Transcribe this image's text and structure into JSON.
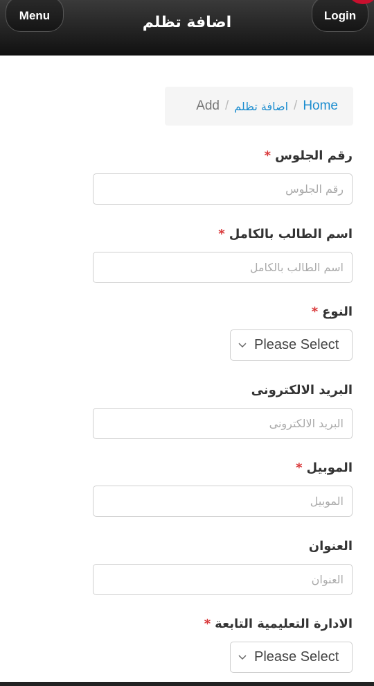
{
  "header": {
    "menu_label": "Menu",
    "title": "اضافة تظلم",
    "login_label": "Login"
  },
  "breadcrumb": {
    "home": "Home",
    "section": "اضافة تظلم",
    "current": "Add",
    "separator": "/"
  },
  "form": {
    "seat_number": {
      "label": "رقم الجلوس",
      "placeholder": "رقم الجلوس",
      "required_mark": "*"
    },
    "full_name": {
      "label": "اسم الطالب بالكامل",
      "placeholder": "اسم الطالب بالكامل",
      "required_mark": "*"
    },
    "gender": {
      "label": "النوع",
      "value": "Please Select",
      "required_mark": "*"
    },
    "email": {
      "label": "البريد الالكترونى",
      "placeholder": "البريد الالكترونى"
    },
    "mobile": {
      "label": "الموبيل",
      "placeholder": "الموبيل",
      "required_mark": "*"
    },
    "address": {
      "label": "العنوان",
      "placeholder": "العنوان"
    },
    "admin": {
      "label": "الادارة التعليمية التابعة",
      "value": "Please Select",
      "required_mark": "*"
    }
  },
  "colors": {
    "header_bg": "#1a1a1a",
    "link": "#1a8ccf",
    "required": "#d9383a"
  },
  "icons": {
    "select": "chevron-down-icon"
  }
}
